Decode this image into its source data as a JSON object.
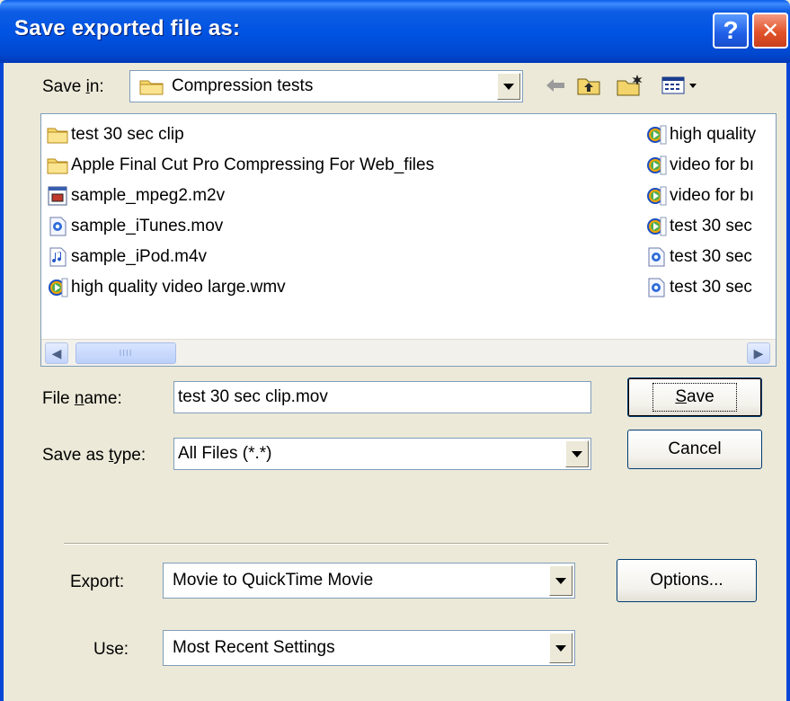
{
  "window": {
    "title": "Save exported file as:",
    "help_glyph": "?",
    "close_glyph": "✕"
  },
  "save_in": {
    "label_pre": "Save ",
    "label_u": "i",
    "label_post": "n:",
    "value": "Compression tests",
    "icon": "folder-icon"
  },
  "toolbar": {
    "back_icon": "back-arrow-icon",
    "up_icon": "up-folder-icon",
    "new_folder_icon": "new-folder-icon",
    "view_icon": "view-menu-icon"
  },
  "files_col1": [
    {
      "name": "test 30 sec clip",
      "icon": "folder-icon"
    },
    {
      "name": "Apple Final Cut Pro  Compressing For Web_files",
      "icon": "folder-icon"
    },
    {
      "name": "sample_mpeg2.m2v",
      "icon": "video-file-icon"
    },
    {
      "name": "sample_iTunes.mov",
      "icon": "quicktime-file-icon"
    },
    {
      "name": "sample_iPod.m4v",
      "icon": "music-file-icon"
    },
    {
      "name": "high quality video large.wmv",
      "icon": "windows-media-icon"
    }
  ],
  "files_col2": [
    {
      "name": "high quality",
      "icon": "windows-media-icon"
    },
    {
      "name": "video for bı",
      "icon": "windows-media-icon"
    },
    {
      "name": "video for bı",
      "icon": "windows-media-icon"
    },
    {
      "name": "test 30 sec",
      "icon": "windows-media-icon"
    },
    {
      "name": "test 30 sec",
      "icon": "quicktime-file-icon"
    },
    {
      "name": "test 30 sec",
      "icon": "quicktime-file-icon"
    }
  ],
  "scrollbar": {
    "thumb_grip": "IIII",
    "left_arrow": "◀",
    "right_arrow": "▶"
  },
  "file_name": {
    "label_pre": "File ",
    "label_u": "n",
    "label_post": "ame:",
    "value": "test 30 sec clip.mov"
  },
  "save_as_type": {
    "label_pre": "Save as ",
    "label_u": "t",
    "label_post": "ype:",
    "value": "All Files (*.*)"
  },
  "buttons": {
    "save_u": "S",
    "save_rest": "ave",
    "cancel": "Cancel",
    "options": "Options..."
  },
  "export": {
    "label": "Export:",
    "value": "Movie to QuickTime Movie"
  },
  "use": {
    "label": "Use:",
    "value": "Most Recent Settings"
  },
  "colors": {
    "titlebar": "#0054e3",
    "dialog_bg": "#ece9d8",
    "close_red": "#e2532a"
  }
}
